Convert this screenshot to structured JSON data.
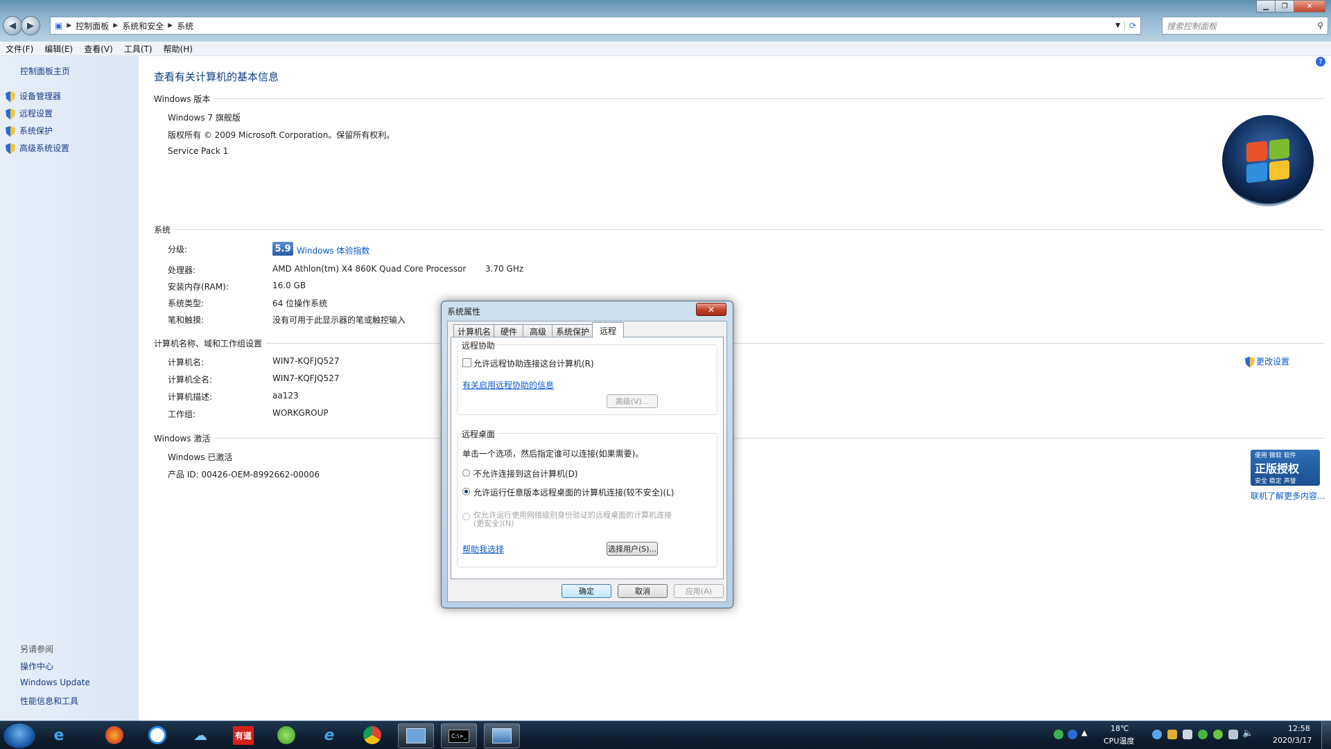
{
  "titlebar": {
    "breadcrumb": [
      "控制面板",
      "系统和安全",
      "系统"
    ],
    "search_placeholder": "搜索控制面板"
  },
  "menu": [
    "文件(F)",
    "编辑(E)",
    "查看(V)",
    "工具(T)",
    "帮助(H)"
  ],
  "sidebar": {
    "home": "控制面板主页",
    "items": [
      "设备管理器",
      "远程设置",
      "系统保护",
      "高级系统设置"
    ],
    "see_also_heading": "另请参阅",
    "see_also": [
      "操作中心",
      "Windows Update",
      "性能信息和工具"
    ]
  },
  "main": {
    "title": "查看有关计算机的基本信息",
    "edition": {
      "heading": "Windows 版本",
      "name": "Windows 7 旗舰版",
      "copyright": "版权所有 © 2009 Microsoft Corporation。保留所有权利。",
      "service_pack": "Service Pack 1"
    },
    "system": {
      "heading": "系统",
      "rating_label": "分级:",
      "rating_score": "5.9",
      "rating_link": "Windows 体验指数",
      "processor_label": "处理器:",
      "processor": "AMD Athlon(tm) X4 860K Quad Core Processor",
      "processor_speed": "3.70 GHz",
      "ram_label": "安装内存(RAM):",
      "ram": "16.0 GB",
      "type_label": "系统类型:",
      "type": "64 位操作系统",
      "pen_label": "笔和触摸:",
      "pen": "没有可用于此显示器的笔或触控输入"
    },
    "computer": {
      "heading": "计算机名称、域和工作组设置",
      "change_link": "更改设置",
      "name_label": "计算机名:",
      "name": "WIN7-KQFJQ527",
      "fullname_label": "计算机全名:",
      "fullname": "WIN7-KQFJQ527",
      "desc_label": "计算机描述:",
      "desc": "aa123",
      "workgroup_label": "工作组:",
      "workgroup": "WORKGROUP"
    },
    "activation": {
      "heading": "Windows 激活",
      "status": "Windows 已激活",
      "product_id": "产品 ID: 00426-OEM-8992662-00006",
      "genuine_top": "使用 微软 软件",
      "genuine_main": "正版授权",
      "genuine_sub": "安全 稳定 声誉",
      "genuine_link": "联机了解更多内容..."
    }
  },
  "dialog": {
    "title": "系统属性",
    "close": "✕",
    "tabs": [
      "计算机名",
      "硬件",
      "高级",
      "系统保护",
      "远程"
    ],
    "assist": {
      "heading": "远程协助",
      "allow": "允许远程协助连接这台计算机(R)",
      "info_link": "有关启用远程协助的信息",
      "advanced": "高级(V)..."
    },
    "desktop": {
      "heading": "远程桌面",
      "instruction": "单击一个选项，然后指定谁可以连接(如果需要)。",
      "opt_none": "不允许连接到这台计算机(D)",
      "opt_any": "允许运行任意版本远程桌面的计算机连接(较不安全)(L)",
      "opt_nla": "仅允许运行使用网络级别身份验证的远程桌面的计算机连接(更安全)(N)",
      "help_link": "帮助我选择",
      "select_users": "选择用户(S)..."
    },
    "ok": "确定",
    "cancel": "取消",
    "apply": "应用(A)"
  },
  "taskbar": {
    "apps": [
      "ie-icon",
      "firefox-icon",
      "baidu-netdisk-icon",
      "cloud-icon",
      "youdao-icon",
      "update-icon",
      "ie2-icon",
      "chrome-icon",
      "remote-icon",
      "cmd-icon",
      "system-icon"
    ],
    "youdao_label": "有道",
    "cmd_label": "C:\\>_",
    "temperature": "18℃",
    "temp_label": "CPU温度",
    "time": "12:58",
    "date": "2020/3/17"
  },
  "colors": {
    "link": "#1a3d8a",
    "title_blue": "#0e3f87",
    "taskbar": "#13263a"
  }
}
